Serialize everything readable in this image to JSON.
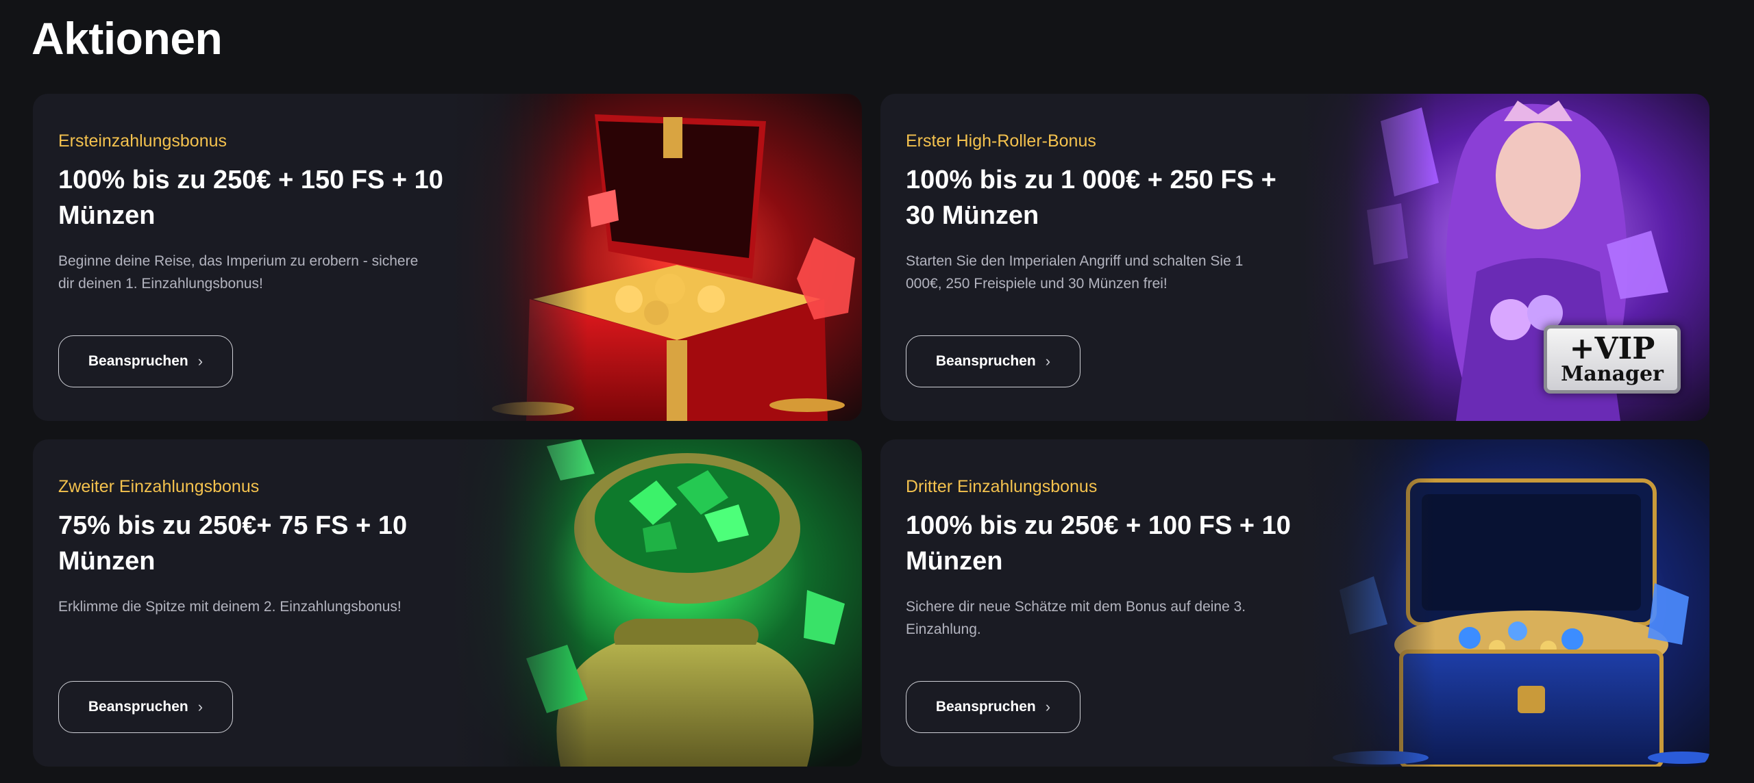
{
  "page": {
    "title": "Aktionen"
  },
  "promotions": [
    {
      "kicker": "Ersteinzahlungsbonus",
      "headline": "100% bis zu 250€ + 150 FS + 10 Münzen",
      "description": "Beginne deine Reise, das Imperium zu erobern - sichere dir deinen 1. Einzahlungsbonus!",
      "button": "Beanspruchen",
      "art": "red-treasure-chest-illustration"
    },
    {
      "kicker": "Erster High-Roller-Bonus",
      "headline": "100% bis zu 1 000€ + 250 FS + 30 Münzen",
      "description": "Starten Sie den Imperialen Angriff und schalten Sie 1 000€, 250 Freispiele und 30 Münzen frei!",
      "button": "Beanspruchen",
      "art": "purple-queen-illustration",
      "badge": {
        "line1": "+VIP",
        "line2": "Manager"
      }
    },
    {
      "kicker": "Zweiter Einzahlungsbonus",
      "headline": "75% bis zu 250€+ 75 FS + 10 Münzen",
      "description": "Erklimme die Spitze mit deinem 2. Einzahlungsbonus!",
      "button": "Beanspruchen",
      "art": "emerald-sack-illustration"
    },
    {
      "kicker": "Dritter Einzahlungsbonus",
      "headline": "100% bis zu 250€ + 100 FS + 10 Münzen",
      "description": "Sichere dir neue Schätze mit dem Bonus auf deine 3. Einzahlung.",
      "button": "Beanspruchen",
      "art": "blue-treasure-chest-illustration"
    }
  ],
  "colors": {
    "background": "#121316",
    "card": "#1a1b23",
    "kicker": "#f4c24e",
    "description": "#b3b4bf",
    "button_border": "#cfd0d6"
  }
}
